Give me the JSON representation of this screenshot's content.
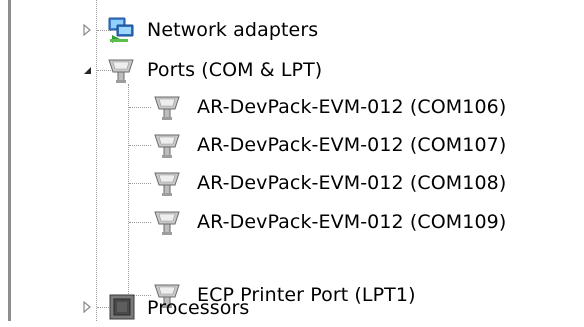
{
  "tree": {
    "network_adapters": {
      "label": "Network adapters",
      "expanded": false
    },
    "ports": {
      "label": "Ports (COM & LPT)",
      "expanded": true,
      "children": [
        {
          "label": "AR-DevPack-EVM-012 (COM106)"
        },
        {
          "label": "AR-DevPack-EVM-012 (COM107)"
        },
        {
          "label": "AR-DevPack-EVM-012 (COM108)"
        },
        {
          "label": "AR-DevPack-EVM-012 (COM109)"
        },
        {
          "label": "ECP Printer Port (LPT1)"
        }
      ]
    },
    "processors": {
      "label": "Processors",
      "expanded": false
    }
  }
}
